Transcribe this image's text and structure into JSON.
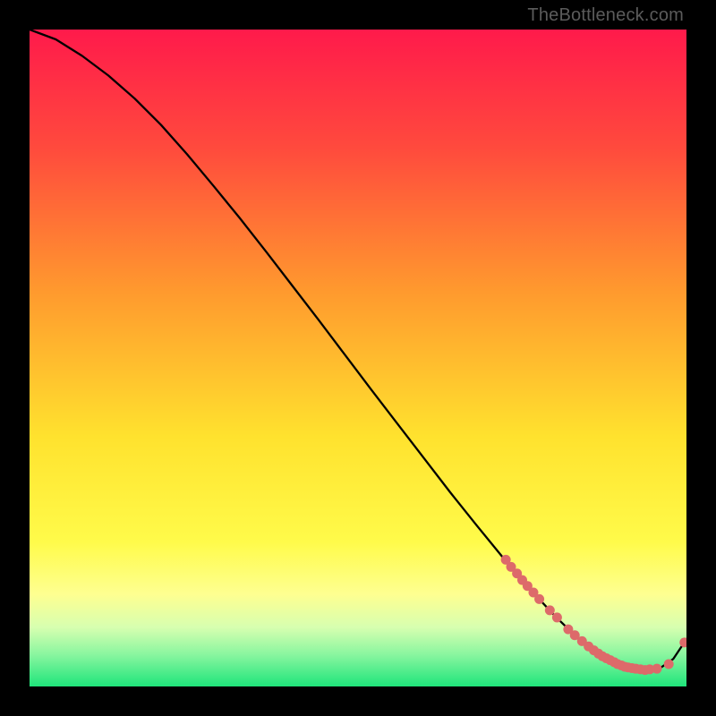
{
  "watermark": "TheBottleneck.com",
  "colors": {
    "top": "#ff1a4b",
    "mid_orange": "#ffa22e",
    "mid_yellow": "#ffef2e",
    "pale_yellow": "#feff91",
    "bottom_green": "#1fe57b",
    "curve": "#000000",
    "marker": "#dd6a6a",
    "bg": "#000000"
  },
  "chart_data": {
    "type": "line",
    "title": "",
    "xlabel": "",
    "ylabel": "",
    "xlim": [
      0,
      100
    ],
    "ylim": [
      0,
      100
    ],
    "grid": false,
    "legend": false,
    "series": [
      {
        "name": "curve",
        "x": [
          0,
          4,
          8,
          12,
          16,
          20,
          24,
          28,
          32,
          36,
          40,
          44,
          48,
          52,
          56,
          60,
          64,
          68,
          72,
          76,
          80,
          83,
          86,
          88,
          90,
          92,
          94,
          96,
          98,
          100
        ],
        "y": [
          100,
          98.5,
          96,
          93,
          89.5,
          85.5,
          81,
          76.2,
          71.3,
          66.2,
          61,
          55.8,
          50.5,
          45.2,
          40,
          34.8,
          29.6,
          24.6,
          19.7,
          15,
          10.7,
          7.8,
          5.4,
          4.1,
          3.2,
          2.7,
          2.5,
          2.8,
          4.2,
          7.2
        ]
      }
    ],
    "markers": [
      {
        "x": 72.5,
        "y": 19.3
      },
      {
        "x": 73.3,
        "y": 18.2
      },
      {
        "x": 74.2,
        "y": 17.2
      },
      {
        "x": 75.0,
        "y": 16.2
      },
      {
        "x": 75.8,
        "y": 15.3
      },
      {
        "x": 76.7,
        "y": 14.3
      },
      {
        "x": 77.6,
        "y": 13.3
      },
      {
        "x": 79.2,
        "y": 11.6
      },
      {
        "x": 80.3,
        "y": 10.5
      },
      {
        "x": 82.0,
        "y": 8.7
      },
      {
        "x": 83.0,
        "y": 7.8
      },
      {
        "x": 84.1,
        "y": 6.9
      },
      {
        "x": 85.1,
        "y": 6.1
      },
      {
        "x": 85.9,
        "y": 5.5
      },
      {
        "x": 86.6,
        "y": 5.0
      },
      {
        "x": 87.2,
        "y": 4.6
      },
      {
        "x": 87.8,
        "y": 4.3
      },
      {
        "x": 88.4,
        "y": 4.0
      },
      {
        "x": 89.0,
        "y": 3.7
      },
      {
        "x": 89.5,
        "y": 3.4
      },
      {
        "x": 90.1,
        "y": 3.2
      },
      {
        "x": 90.6,
        "y": 3.0
      },
      {
        "x": 91.1,
        "y": 2.9
      },
      {
        "x": 91.7,
        "y": 2.8
      },
      {
        "x": 92.3,
        "y": 2.7
      },
      {
        "x": 93.0,
        "y": 2.6
      },
      {
        "x": 93.7,
        "y": 2.5
      },
      {
        "x": 94.4,
        "y": 2.6
      },
      {
        "x": 95.5,
        "y": 2.7
      },
      {
        "x": 97.3,
        "y": 3.4
      },
      {
        "x": 99.7,
        "y": 6.7
      }
    ]
  }
}
